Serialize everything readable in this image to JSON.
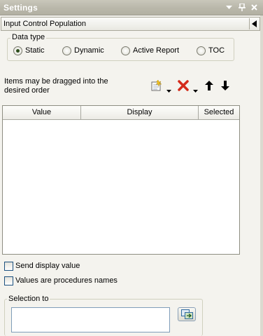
{
  "window": {
    "title": "Settings"
  },
  "titlebar_icons": [
    "dropdown-arrow-icon",
    "pin-icon",
    "close-icon"
  ],
  "section": {
    "title": "Input Control Population"
  },
  "data_type": {
    "legend": "Data type",
    "options": [
      "Static",
      "Dynamic",
      "Active Report",
      "TOC"
    ],
    "selected": "Static"
  },
  "hint": "Items may be dragged into the desired order",
  "toolbar_icons": [
    "new-item-icon",
    "dropdown-arrow-icon",
    "delete-icon",
    "dropdown-arrow-icon",
    "move-up-icon",
    "move-down-icon"
  ],
  "table": {
    "columns": [
      "Value",
      "Display",
      "Selected"
    ],
    "rows": []
  },
  "checkboxes": {
    "send_display_value": "Send display value",
    "values_procedures": "Values are procedures names"
  },
  "selection_to": {
    "legend": "Selection to",
    "value": ""
  },
  "colors": {
    "titlebar": "#bab8ab",
    "panel_bg": "#f4f3ee",
    "radio_dot": "#2c4c1a",
    "delete_red": "#d42a1a"
  }
}
